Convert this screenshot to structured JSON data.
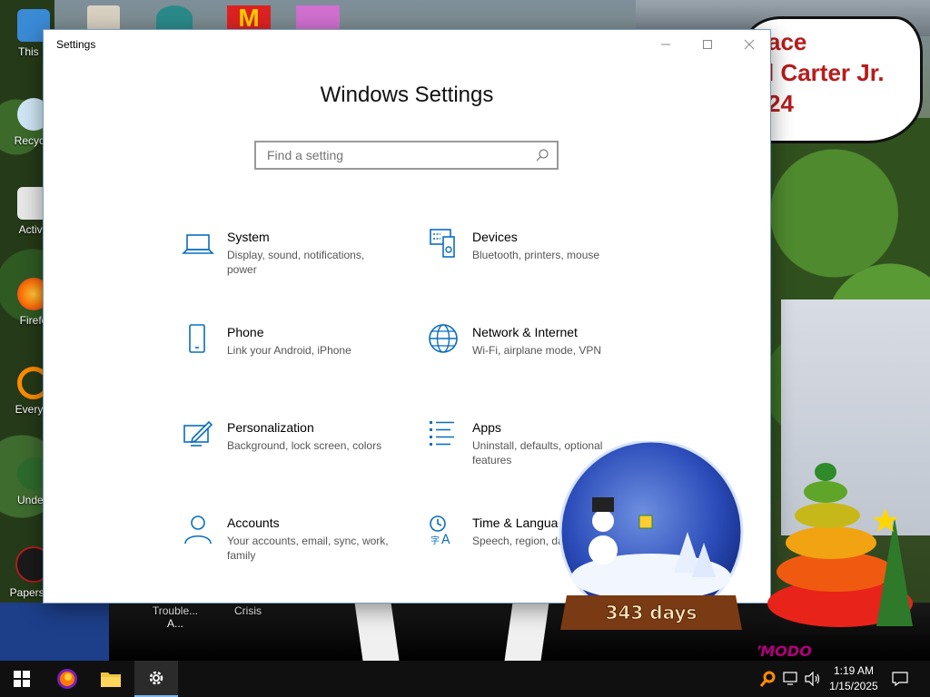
{
  "wallpaper": {
    "bubble_lines": [
      "ace",
      "l Carter Jr.",
      "24"
    ],
    "snowglobe_text": "343 days",
    "gadget_watermark": "VMODO"
  },
  "desktop_icons": [
    {
      "label": "This P",
      "icon": "computer-icon"
    },
    {
      "label": "Recycle",
      "icon": "recycle-bin-icon"
    },
    {
      "label": "Activa",
      "icon": "activation-icon"
    },
    {
      "label": "Firefo",
      "icon": "firefox-icon"
    },
    {
      "label": "Everyth",
      "icon": "everything-search-icon"
    },
    {
      "label": "Undert",
      "icon": "undertale-icon"
    },
    {
      "label": "Papers, P",
      "icon": "papers-please-icon"
    },
    {
      "label": "Trouble... A...",
      "icon": "app-icon"
    },
    {
      "label": "Crisis",
      "icon": "app-icon"
    }
  ],
  "window": {
    "title": "Settings",
    "heading": "Windows Settings",
    "search_placeholder": "Find a setting",
    "controls": {
      "minimize": "—",
      "maximize": "☐",
      "close": "✕"
    },
    "tiles": [
      {
        "name": "System",
        "desc": "Display, sound, notifications, power",
        "icon": "laptop-icon"
      },
      {
        "name": "Devices",
        "desc": "Bluetooth, printers, mouse",
        "icon": "devices-icon"
      },
      {
        "name": "Phone",
        "desc": "Link your Android, iPhone",
        "icon": "phone-icon"
      },
      {
        "name": "Network & Internet",
        "desc": "Wi-Fi, airplane mode, VPN",
        "icon": "globe-icon"
      },
      {
        "name": "Personalization",
        "desc": "Background, lock screen, colors",
        "icon": "paint-icon"
      },
      {
        "name": "Apps",
        "desc": "Uninstall, defaults, optional features",
        "icon": "apps-list-icon"
      },
      {
        "name": "Accounts",
        "desc": "Your accounts, email, sync, work, family",
        "icon": "person-icon"
      },
      {
        "name": "Time & Langua",
        "desc": "Speech, region, da",
        "icon": "time-language-icon"
      }
    ]
  },
  "taskbar": {
    "items": [
      {
        "name": "start",
        "icon": "windows-start-icon"
      },
      {
        "name": "firefox",
        "icon": "firefox-icon"
      },
      {
        "name": "file-explorer",
        "icon": "folder-icon"
      },
      {
        "name": "settings",
        "icon": "gear-icon",
        "active": true
      }
    ],
    "tray_icons": [
      "search-app-icon",
      "network-icon",
      "volume-icon"
    ],
    "time": "1:19 AM",
    "date": "1/15/2025",
    "notification_icon": "notification-icon"
  },
  "colors": {
    "accent": "#0a6ebd",
    "taskbar": "#101010"
  }
}
